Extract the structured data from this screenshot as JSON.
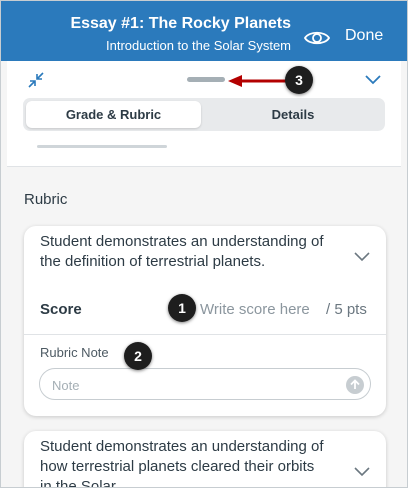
{
  "header": {
    "title": "Essay #1: The Rocky Planets",
    "subtitle": "Introduction to the Solar System",
    "done_label": "Done",
    "color": "#2b7abc"
  },
  "tabs": [
    {
      "label": "Grade & Rubric",
      "selected": true
    },
    {
      "label": "Details",
      "selected": false
    }
  ],
  "rubric": {
    "title": "Rubric",
    "criteria": [
      {
        "description": "Student demonstrates an understanding of the definition of terrestrial planets.",
        "score_label": "Score",
        "score_placeholder": "Write score here",
        "points_possible": "/ 5 pts",
        "note_label": "Rubric Note",
        "note_placeholder": "Note"
      },
      {
        "description": "Student demonstrates an understanding of how terrestrial planets cleared their orbits in the Solar"
      }
    ]
  },
  "callouts": [
    "1",
    "2",
    "3"
  ],
  "callout_arrow_color": "#b30000"
}
